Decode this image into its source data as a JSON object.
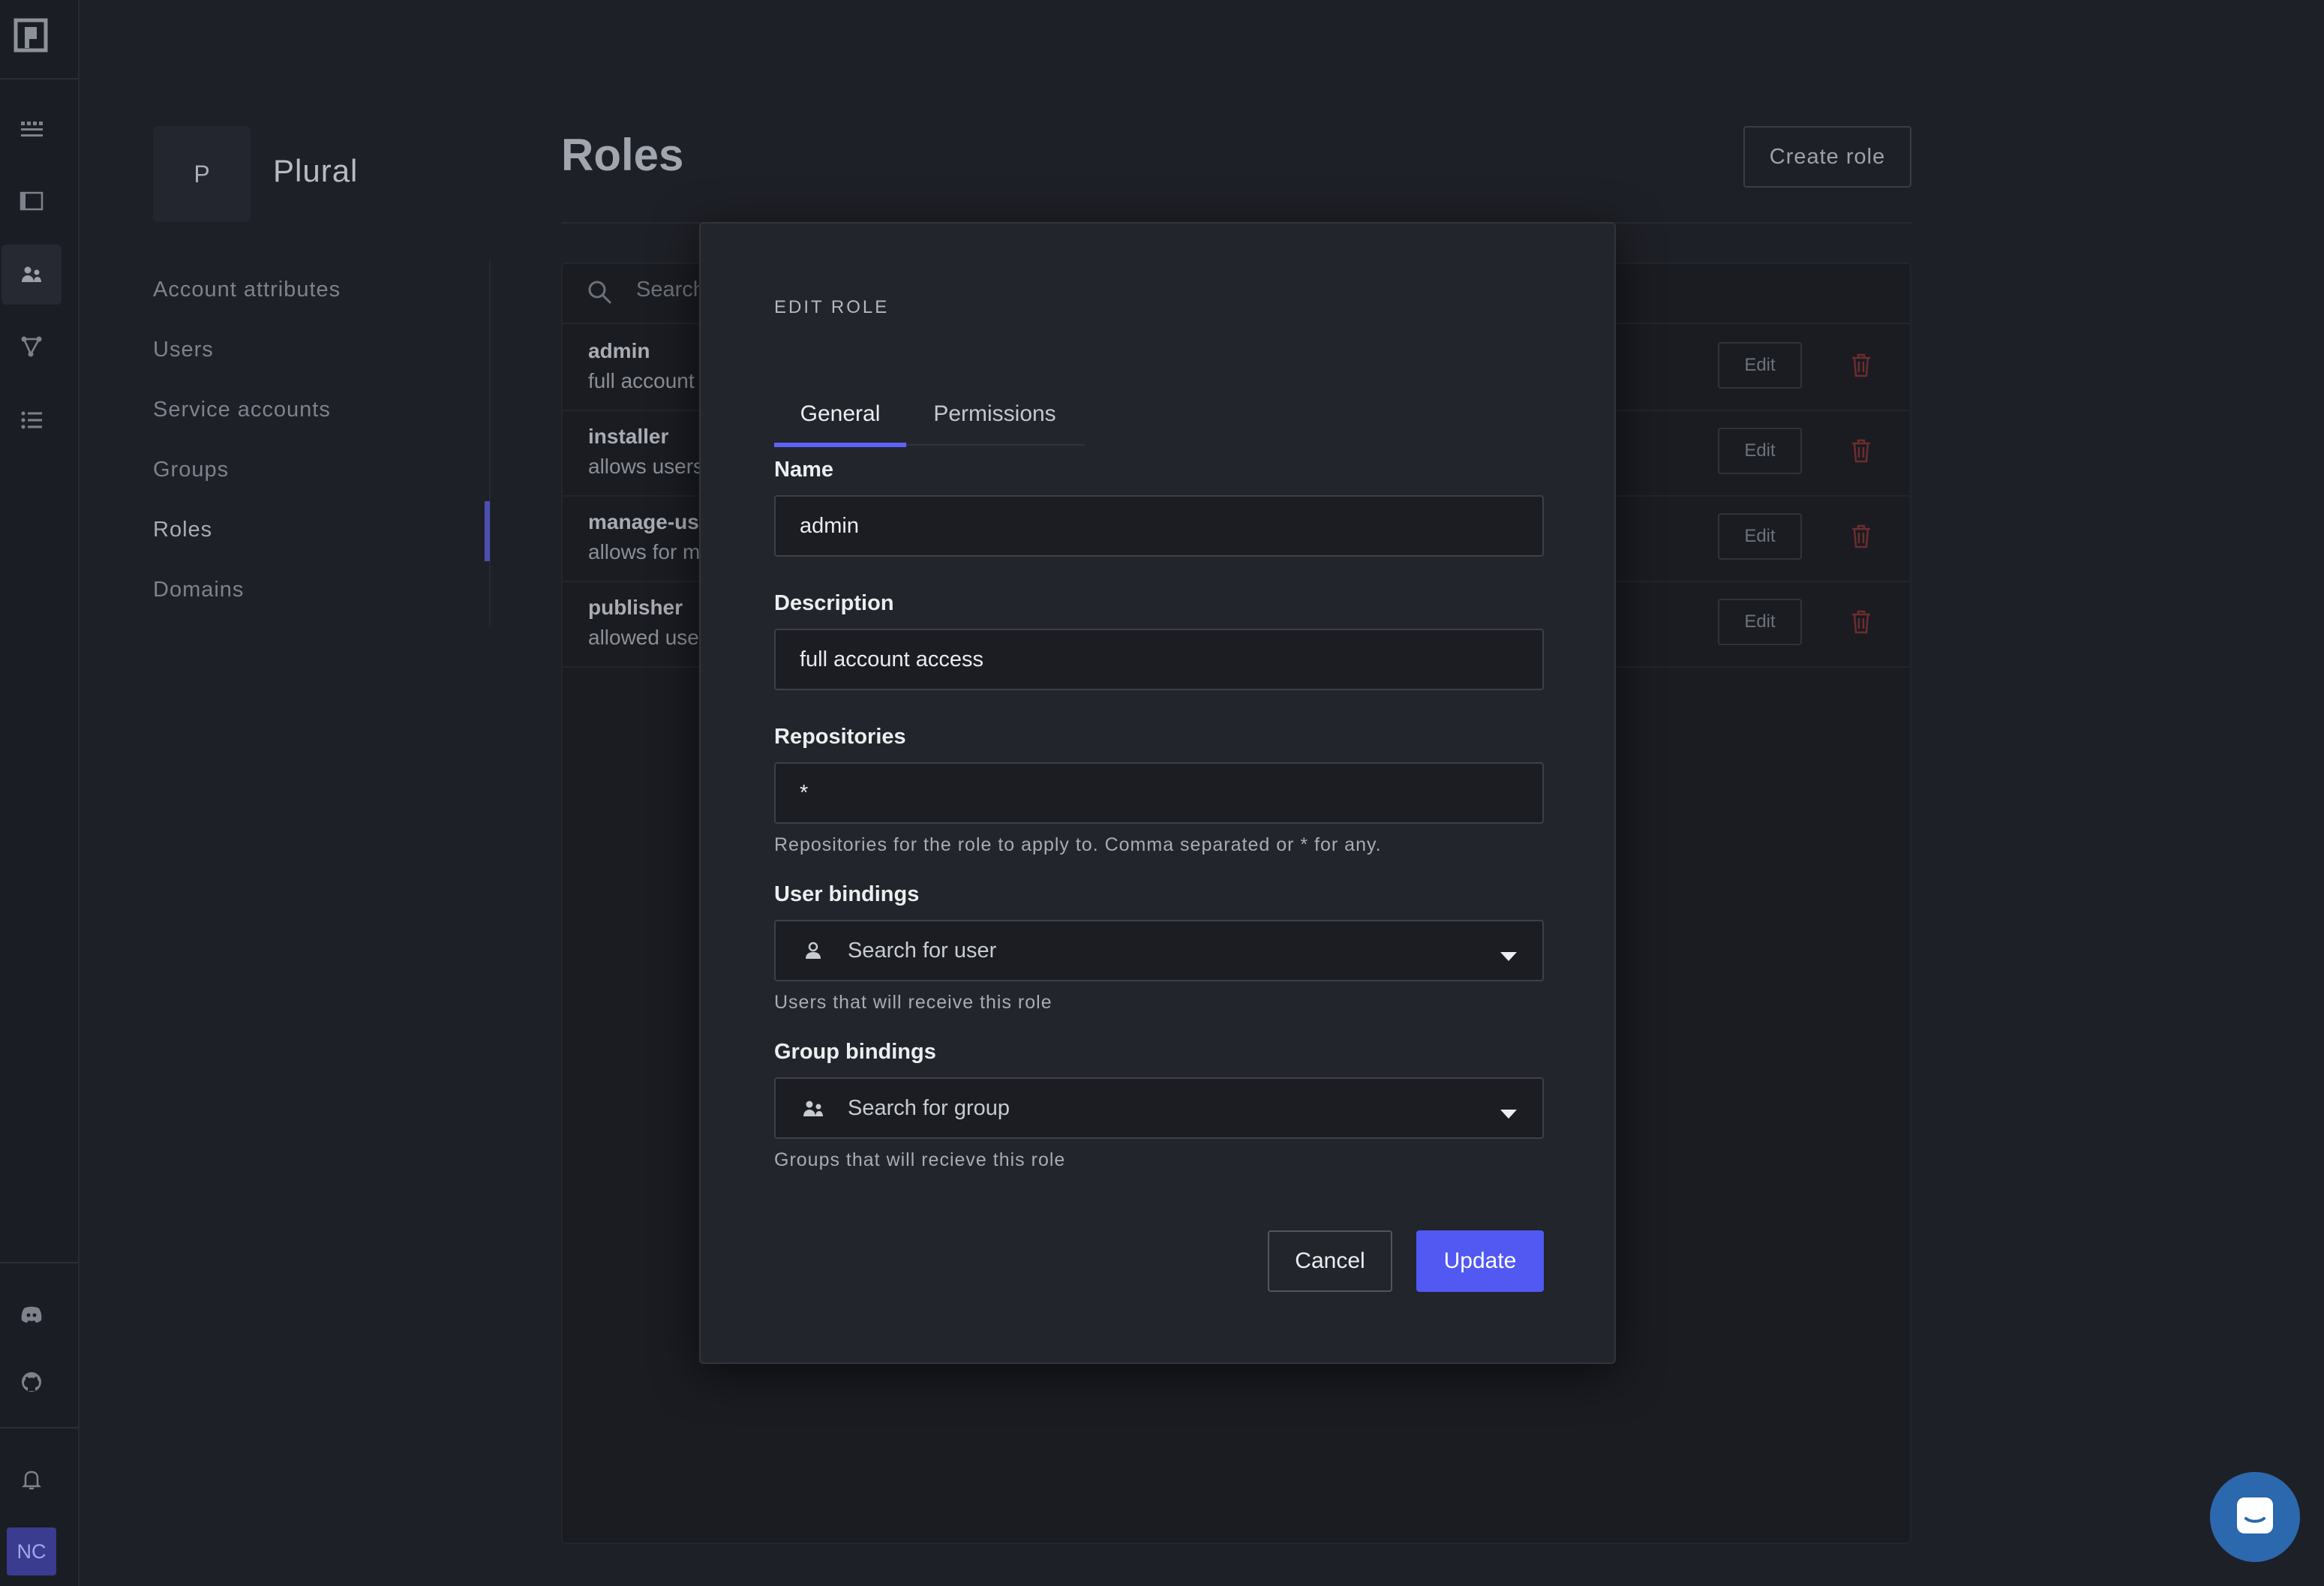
{
  "sidebar_nav": {
    "account_initial": "P",
    "account_name": "Plural",
    "items": [
      {
        "label": "Account attributes"
      },
      {
        "label": "Users"
      },
      {
        "label": "Service accounts"
      },
      {
        "label": "Groups"
      },
      {
        "label": "Roles",
        "active": true
      },
      {
        "label": "Domains"
      }
    ]
  },
  "rail": {
    "icons": [
      "plural-logo-icon",
      "marketplace-icon",
      "terminal-icon",
      "people-icon",
      "graph-icon",
      "list-icon",
      "discord-icon",
      "github-icon",
      "bell-icon"
    ],
    "avatar_initials": "NC"
  },
  "main": {
    "title": "Roles",
    "create_button": "Create role",
    "search_placeholder": "Search",
    "edit_label": "Edit",
    "roles": [
      {
        "name": "admin",
        "description": "full account access"
      },
      {
        "name": "installer",
        "description": "allows users to install"
      },
      {
        "name": "manage-us",
        "description": "allows for m"
      },
      {
        "name": "publisher",
        "description": "allowed use"
      }
    ]
  },
  "modal": {
    "heading": "EDIT ROLE",
    "tabs": [
      "General",
      "Permissions"
    ],
    "active_tab": "General",
    "name_label": "Name",
    "name_value": "admin",
    "description_label": "Description",
    "description_value": "full account access",
    "repositories_label": "Repositories",
    "repositories_value": "*",
    "repositories_hint": "Repositories for the role to apply to. Comma separated or * for any.",
    "user_bindings_label": "User bindings",
    "user_bindings_placeholder": "Search for user",
    "user_bindings_hint": "Users that will receive this role",
    "group_bindings_label": "Group bindings",
    "group_bindings_placeholder": "Search for group",
    "group_bindings_hint": "Groups that will recieve this role",
    "cancel_label": "Cancel",
    "update_label": "Update"
  },
  "colors": {
    "accent": "#5258f2",
    "background": "#1e2027",
    "modal": "#22252c",
    "danger": "#8a2b2b"
  }
}
